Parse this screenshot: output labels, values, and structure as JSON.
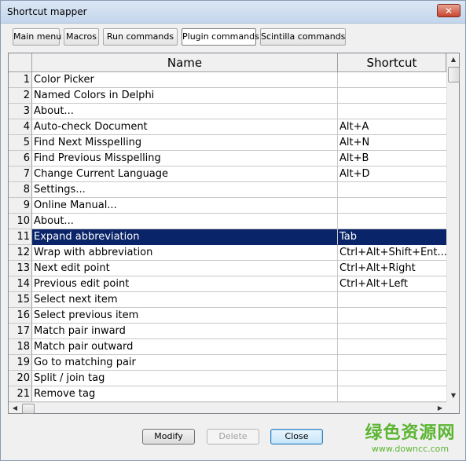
{
  "window": {
    "title": "Shortcut mapper",
    "close_label": "✕"
  },
  "tabs": [
    {
      "label": "Main menu"
    },
    {
      "label": "Macros"
    },
    {
      "label": "Run commands"
    },
    {
      "label": "Plugin commands",
      "active": true
    },
    {
      "label": "Scintilla commands"
    }
  ],
  "grid": {
    "headers": {
      "name": "Name",
      "shortcut": "Shortcut"
    },
    "selected_row": 11,
    "rows": [
      {
        "num": "1",
        "name": "Color Picker",
        "shortcut": ""
      },
      {
        "num": "2",
        "name": "Named Colors in Delphi",
        "shortcut": ""
      },
      {
        "num": "3",
        "name": "About...",
        "shortcut": ""
      },
      {
        "num": "4",
        "name": "Auto-check Document",
        "shortcut": "Alt+A"
      },
      {
        "num": "5",
        "name": "Find Next Misspelling",
        "shortcut": "Alt+N"
      },
      {
        "num": "6",
        "name": "Find Previous Misspelling",
        "shortcut": "Alt+B"
      },
      {
        "num": "7",
        "name": "Change Current Language",
        "shortcut": "Alt+D"
      },
      {
        "num": "8",
        "name": "Settings...",
        "shortcut": ""
      },
      {
        "num": "9",
        "name": "Online Manual...",
        "shortcut": ""
      },
      {
        "num": "10",
        "name": "About...",
        "shortcut": ""
      },
      {
        "num": "11",
        "name": "Expand abbreviation",
        "shortcut": "Tab"
      },
      {
        "num": "12",
        "name": "Wrap with abbreviation",
        "shortcut": "Ctrl+Alt+Shift+Ent..."
      },
      {
        "num": "13",
        "name": "Next edit point",
        "shortcut": "Ctrl+Alt+Right"
      },
      {
        "num": "14",
        "name": "Previous edit point",
        "shortcut": "Ctrl+Alt+Left"
      },
      {
        "num": "15",
        "name": "Select next item",
        "shortcut": ""
      },
      {
        "num": "16",
        "name": "Select previous item",
        "shortcut": ""
      },
      {
        "num": "17",
        "name": "Match pair inward",
        "shortcut": ""
      },
      {
        "num": "18",
        "name": "Match pair outward",
        "shortcut": ""
      },
      {
        "num": "19",
        "name": "Go to matching pair",
        "shortcut": ""
      },
      {
        "num": "20",
        "name": "Split / join tag",
        "shortcut": ""
      },
      {
        "num": "21",
        "name": "Remove tag",
        "shortcut": ""
      }
    ]
  },
  "buttons": {
    "modify": "Modify",
    "delete": "Delete",
    "close": "Close"
  },
  "watermark": {
    "main": "绿色资源网",
    "sub": "www.downcc.com"
  },
  "colors": {
    "selection": "#0a246a",
    "watermark": "#5bb531"
  },
  "icons": {
    "close": "close-icon",
    "scroll_up": "arrow-up-icon",
    "scroll_down": "arrow-down-icon",
    "scroll_left": "arrow-left-icon",
    "scroll_right": "arrow-right-icon"
  }
}
